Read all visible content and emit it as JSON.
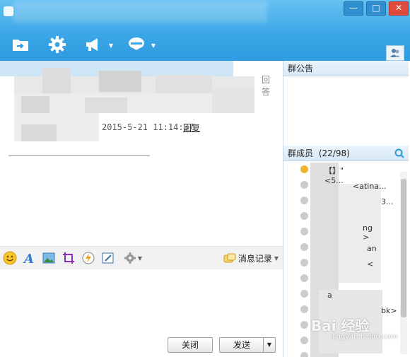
{
  "window": {
    "controls": {
      "minimize": "—",
      "maximize": "□",
      "close": "✕"
    }
  },
  "toolbar": {
    "icons": [
      "folder-share-icon",
      "settings-gear-icon",
      "announce-megaphone-icon",
      "chat-mode-icon"
    ]
  },
  "chat": {
    "side_chars": [
      "回",
      "答"
    ],
    "timestamp": "2015-5-21 11:14:37",
    "reply_label": "回复"
  },
  "input_toolbar": {
    "history_label": "消息记录"
  },
  "buttons": {
    "close_label": "关闭",
    "send_label": "发送",
    "send_dropdown": "▼"
  },
  "right": {
    "announcement_title": "群公告",
    "members_title": "群成员",
    "members_count": "(22/98)",
    "members": [
      {
        "text": "\"#·····【】\"<5...",
        "online": true
      },
      {
        "text": "<atina...",
        "online": false
      },
      {
        "text": "3...",
        "online": false
      },
      {
        "text": "",
        "online": false
      },
      {
        "text": "ng >",
        "online": false
      },
      {
        "text": "an",
        "online": false
      },
      {
        "text": "<",
        "online": false
      },
      {
        "text": "",
        "online": false
      },
      {
        "text": "a",
        "online": false
      },
      {
        "text": "bk>",
        "online": false
      },
      {
        "text": "",
        "online": false
      },
      {
        "text": "",
        "online": false
      },
      {
        "text": "",
        "online": false
      }
    ]
  },
  "watermark": {
    "text": "Bai 经验",
    "sub": "jingyan.baidu.com"
  },
  "colors": {
    "title_bar": "#3ba7e6",
    "close_button": "#e04b3b",
    "online_status": "#f0b431",
    "link": "#333333"
  }
}
